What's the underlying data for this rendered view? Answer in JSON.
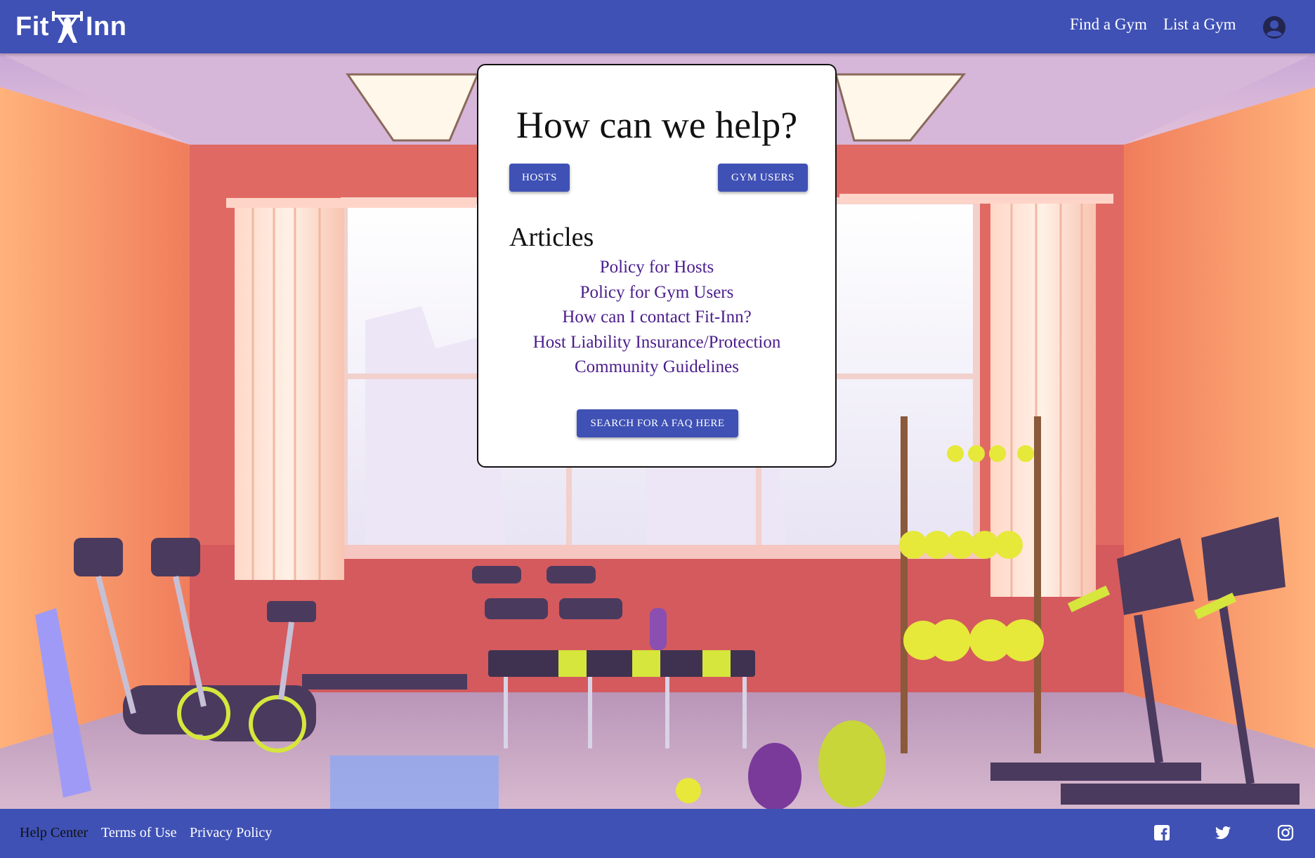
{
  "header": {
    "logo_left": "Fit",
    "logo_right": "Inn",
    "nav": {
      "find_gym": "Find a Gym",
      "list_gym": "List a Gym"
    }
  },
  "help_card": {
    "title": "How can we help?",
    "hosts_button": "HOSTS",
    "gym_users_button": "GYM USERS",
    "articles_heading": "Articles",
    "articles": [
      "Policy for Hosts",
      "Policy for Gym Users",
      "How can I contact Fit-Inn?",
      "Host Liability Insurance/Protection",
      "Community Guidelines"
    ],
    "faq_button": "SEARCH FOR A FAQ HERE"
  },
  "footer": {
    "help_center": "Help Center",
    "terms": "Terms of Use",
    "privacy": "Privacy Policy",
    "social_icons": [
      "facebook-icon",
      "twitter-icon",
      "instagram-icon"
    ]
  },
  "colors": {
    "primary": "#3f51b5",
    "link": "#4a1c8c",
    "card_bg": "#ffffff"
  }
}
